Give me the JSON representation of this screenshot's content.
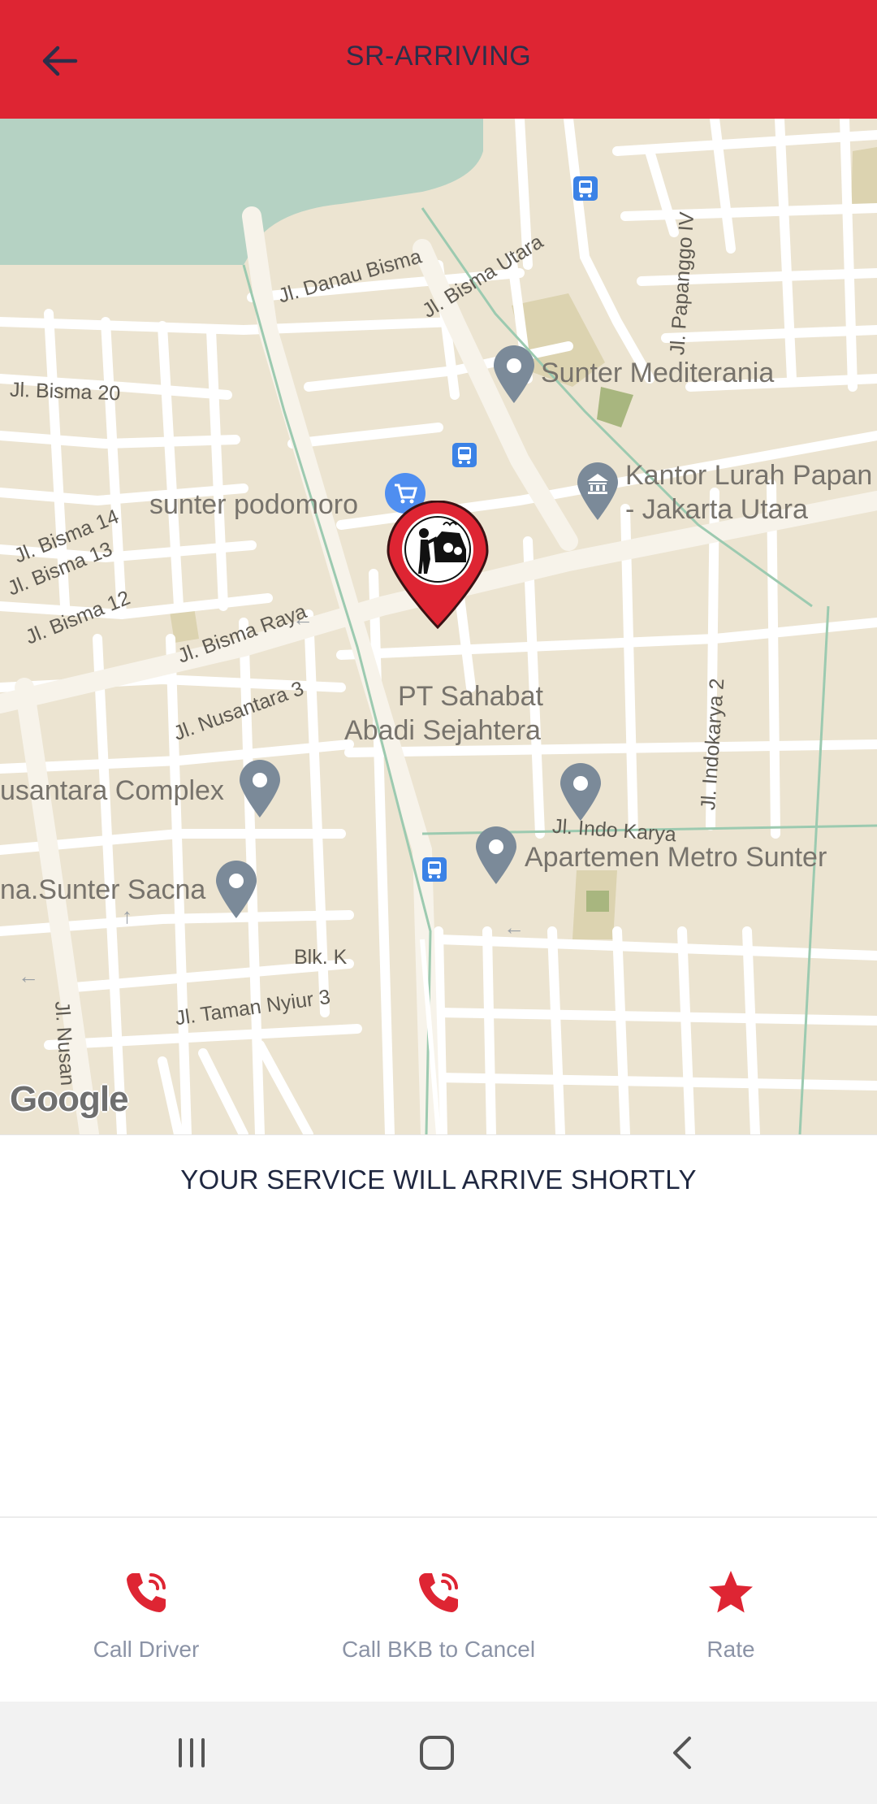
{
  "header": {
    "title": "SR-ARRIVING",
    "back_icon": "arrow-left-icon"
  },
  "map": {
    "roads": {
      "danau_bisma": "Jl. Danau Bisma",
      "bisma_utara": "Jl. Bisma Utara",
      "papanggo_iv": "Jl. Papanggo IV",
      "bisma_20": "Jl. Bisma 20",
      "bisma_14": "Jl. Bisma 14",
      "bisma_13": "Jl. Bisma 13",
      "bisma_12": "Jl. Bisma 12",
      "bisma_raya": "Jl. Bisma Raya",
      "nusantara_3": "Jl. Nusantara 3",
      "indokarya_2": "Jl. Indokarya 2",
      "indo_karya": "Jl. Indo Karya",
      "blk_k": "Blk. K",
      "taman_nyiur_3": "Jl. Taman Nyiur 3",
      "nusan": "Jl. Nusan"
    },
    "pois": {
      "sunter_mediterania": "Sunter Mediterania",
      "sunter_podomoro": "sunter podomoro",
      "kantor_lurah_1": "Kantor Lurah Papan",
      "kantor_lurah_2": "- Jakarta Utara",
      "pt_sahabat_1": "PT Sahabat",
      "pt_sahabat_2": "Abadi Sejahtera",
      "nusantara_complex": "usantara Complex",
      "sunter_sacna": "na.Sunter Sacna",
      "apartemen": "Apartemen Metro Sunter"
    },
    "watermark": "Google",
    "colors": {
      "land": "#ece4d1",
      "water": "#b5d2c3",
      "road": "#ffffff",
      "marker": "#de2533",
      "poi_pin": "#7b8a99"
    }
  },
  "status": {
    "message": "YOUR SERVICE WILL ARRIVE SHORTLY"
  },
  "actions": [
    {
      "label": "Call Driver",
      "icon": "phone-ringing-icon"
    },
    {
      "label": "Call BKB to Cancel",
      "icon": "phone-ringing-icon"
    },
    {
      "label": "Rate",
      "icon": "star-icon"
    }
  ],
  "navbar": {
    "recents_icon": "recents-icon",
    "home_icon": "home-icon",
    "back_icon": "back-chevron-icon"
  }
}
